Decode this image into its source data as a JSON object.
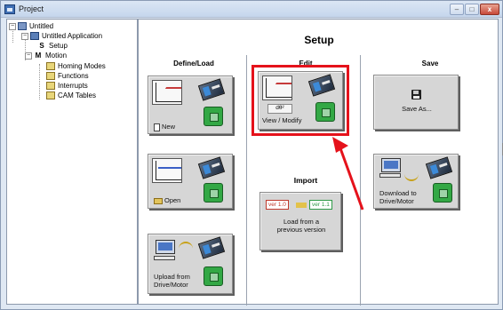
{
  "window": {
    "title": "Project",
    "min_label": "–",
    "max_label": "□",
    "close_label": "x"
  },
  "tree": {
    "root": "Untitled",
    "application": "Untitled Application",
    "setup_glyph": "S",
    "setup": "Setup",
    "motion_glyph": "M",
    "motion": "Motion",
    "motion_children": [
      "Homing Modes",
      "Functions",
      "Interrupts",
      "CAM Tables"
    ]
  },
  "main": {
    "title": "Setup",
    "columns": {
      "define_load": "Define/Load",
      "edit": "Edit",
      "save": "Save"
    },
    "tiles": {
      "new": "New",
      "open": "Open",
      "upload_line1": "Upload from",
      "upload_line2": "Drive/Motor",
      "view_modify": "View / Modify",
      "edit_box_text": "dθ²",
      "save_as": "Save As...",
      "download_line1": "Download to",
      "download_line2": "Drive/Motor"
    },
    "import": {
      "heading": "Import",
      "ver_from": "ver 1.0",
      "ver_to": "ver 1.1",
      "line1": "Load from a",
      "line2": "previous version"
    }
  },
  "colors": {
    "highlight": "#e5121b",
    "tile_bg": "#d6d6d6",
    "motor_green": "#33a845"
  }
}
